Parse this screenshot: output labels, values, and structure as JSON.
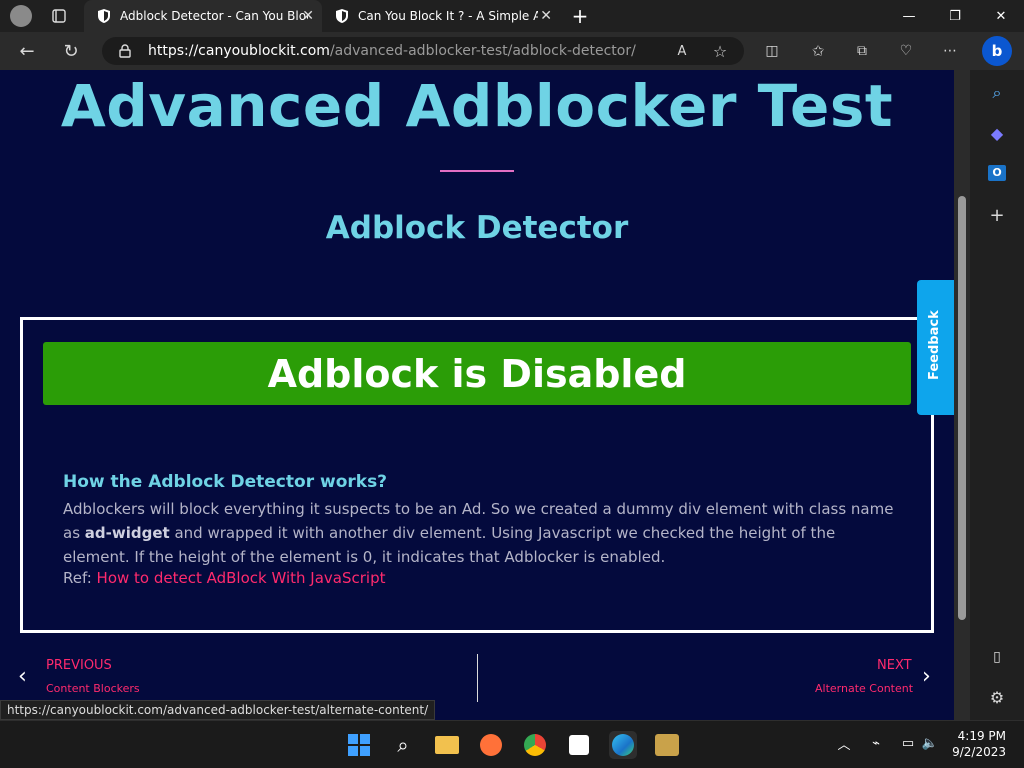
{
  "browser": {
    "tabs": [
      {
        "title": "Adblock Detector - Can You Block",
        "active": true
      },
      {
        "title": "Can You Block It ? - A Simple Ad",
        "active": false
      }
    ],
    "url_host": "https://canyoublockit.com",
    "url_path": "/advanced-adblocker-test/adblock-detector/",
    "status_url": "https://canyoublockit.com/advanced-adblocker-test/alternate-content/"
  },
  "page": {
    "heading": "Advanced Adblocker Test",
    "subheading": "Adblock Detector",
    "status_text": "Adblock is Disabled",
    "how_title": "How the Adblock Detector works?",
    "how_body_1": "Adblockers will block everything it suspects to be an Ad. So we created a dummy div element with class name as ",
    "how_body_bold": "ad-widget",
    "how_body_2": " and wrapped it with another div element. Using Javascript we checked the height of the element. If the height of the element is 0, it indicates that Adblocker is enabled.",
    "ref_label": "Ref: ",
    "ref_link": "How to detect AdBlock With JavaScript",
    "feedback": "Feedback",
    "nav": {
      "prev_label": "PREVIOUS",
      "prev_title": "Content Blockers",
      "next_label": "NEXT",
      "next_title": "Alternate Content"
    }
  },
  "taskbar": {
    "time": "4:19 PM",
    "date": "9/2/2023"
  },
  "colors": {
    "page_bg": "#040a3d",
    "heading": "#6fd3e5",
    "status_green": "#2b9d07",
    "link": "#ff2a6d",
    "feedback": "#0ea5ec"
  }
}
